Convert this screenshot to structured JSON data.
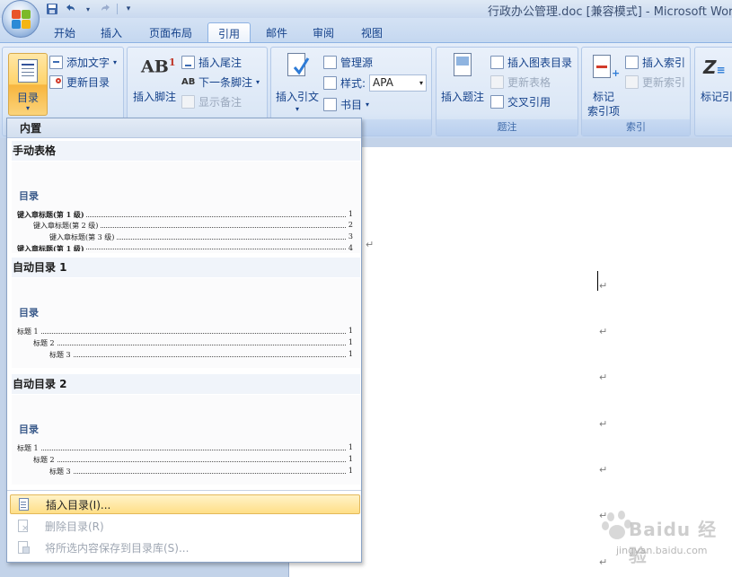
{
  "window": {
    "title": "行政办公管理.doc [兼容模式] - Microsoft Wor"
  },
  "tabs": [
    "开始",
    "插入",
    "页面布局",
    "引用",
    "邮件",
    "审阅",
    "视图"
  ],
  "active_tab": "引用",
  "ribbon": {
    "toc_group": {
      "toc_button": "目录",
      "add_text": "添加文字",
      "update_toc": "更新目录"
    },
    "footnote_group": {
      "insert_footnote": "插入脚注",
      "insert_endnote": "插入尾注",
      "next_footnote": "下一条脚注",
      "show_notes": "显示备注"
    },
    "citation_group": {
      "insert_citation": "插入引文",
      "manage_sources": "管理源",
      "style_label": "样式:",
      "style_value": "APA",
      "bibliography": "书目",
      "group_label": "书目"
    },
    "caption_group": {
      "insert_caption": "插入题注",
      "insert_table_of_figures": "插入图表目录",
      "update_table": "更新表格",
      "cross_reference": "交叉引用",
      "group_label": "题注"
    },
    "index_group": {
      "mark_entry_line1": "标记",
      "mark_entry_line2": "索引项",
      "insert_index": "插入索引",
      "update_index": "更新索引",
      "group_label": "索引"
    },
    "citations_tab_group": {
      "mark_citation": "标记引"
    }
  },
  "gallery": {
    "header": "内置",
    "entries": [
      {
        "title": "手动表格",
        "heading": "目录",
        "lines": [
          {
            "text": "键入章标题(第 1 级)",
            "page": "1"
          },
          {
            "text": "键入章标题(第 2 级)",
            "page": "2"
          },
          {
            "text": "键入章标题(第 3 级)",
            "page": "3"
          },
          {
            "text": "键入章标题(第 1 级)",
            "page": "4"
          }
        ]
      },
      {
        "title": "自动目录 1",
        "heading": "目录",
        "lines": [
          {
            "text": "标题 1",
            "page": "1"
          },
          {
            "text": "标题 2",
            "page": "1"
          },
          {
            "text": "标题 3",
            "page": "1"
          }
        ]
      },
      {
        "title": "自动目录 2",
        "heading": "目录",
        "lines": [
          {
            "text": "标题 1",
            "page": "1"
          },
          {
            "text": "标题 2",
            "page": "1"
          },
          {
            "text": "标题 3",
            "page": "1"
          }
        ]
      }
    ],
    "menu": {
      "insert_toc": "插入目录(I)...",
      "remove_toc": "删除目录(R)",
      "save_selection": "将所选内容保存到目录库(S)..."
    }
  },
  "document": {
    "paragraph_mark": "↵"
  },
  "watermark": {
    "text": "Baidu 经验",
    "url": "jingyan.baidu.com"
  }
}
